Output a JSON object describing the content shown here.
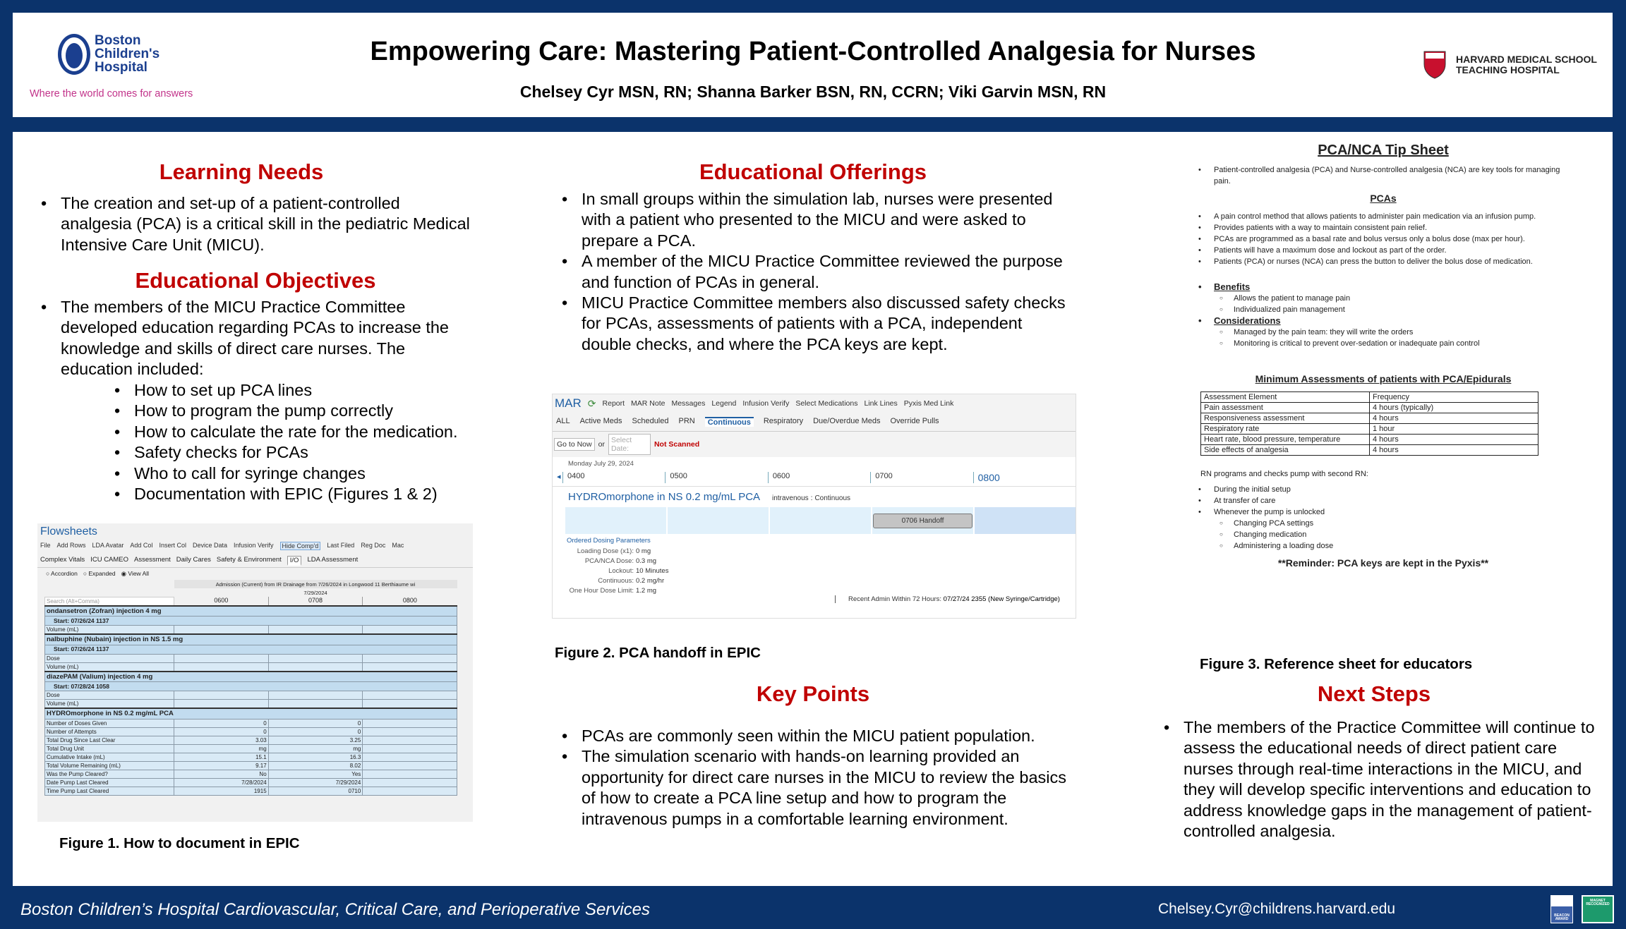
{
  "header": {
    "title": "Empowering Care: Mastering Patient-Controlled Analgesia for Nurses",
    "authors": "Chelsey Cyr MSN, RN; Shanna Barker BSN, RN, CCRN; Viki Garvin MSN, RN",
    "logo_left": {
      "name": "Boston Children's Hospital",
      "lines": [
        "Boston",
        "Children's",
        "Hospital"
      ],
      "tagline": "Where the world comes for answers"
    },
    "logo_right": {
      "lines": [
        "HARVARD MEDICAL SCHOOL",
        "TEACHING HOSPITAL"
      ]
    }
  },
  "colors": {
    "navy": "#0b336b",
    "heading_red": "#c00000",
    "tagline_pink": "#c2338a"
  },
  "learning_needs": {
    "heading": "Learning Needs",
    "bullets": [
      "The creation and set-up of a patient-controlled analgesia (PCA) is a critical skill in the pediatric Medical Intensive Care Unit (MICU)."
    ]
  },
  "objectives": {
    "heading": "Educational Objectives",
    "intro": "The members of the MICU Practice Committee developed education regarding PCAs to increase the knowledge and skills of direct care nurses. The education included:",
    "items": [
      "How to set up PCA lines",
      "How to program the pump correctly",
      "How to calculate the rate for the medication.",
      "Safety checks for PCAs",
      "Who to call for syringe changes",
      "Documentation with EPIC (Figures 1 & 2)"
    ]
  },
  "offerings": {
    "heading": "Educational Offerings",
    "bullets": [
      "In small groups within the simulation lab, nurses were presented with a patient who presented to the MICU and were asked to prepare a PCA.",
      "A member of the MICU Practice Committee reviewed the purpose and function of PCAs in general.",
      "MICU Practice Committee members also discussed safety checks for PCAs, assessments of patients with a PCA, independent double checks, and where the PCA keys are kept."
    ]
  },
  "key_points": {
    "heading": "Key Points",
    "bullets": [
      "PCAs are commonly seen within the MICU patient population.",
      "The simulation scenario with hands-on learning provided an opportunity for direct care nurses in the MICU to review the basics of how to create a PCA line setup and how to program the intravenous pumps in a comfortable learning environment."
    ]
  },
  "next_steps": {
    "heading": "Next Steps",
    "bullets": [
      "The members of the Practice Committee will continue to assess the educational needs of direct patient care nurses through real-time interactions in the MICU, and they will develop specific interventions and education to address knowledge gaps in the management of patient-controlled analgesia."
    ]
  },
  "figure1": {
    "caption": "Figure 1. How to document in EPIC",
    "title": "Flowsheets",
    "toolbar": [
      "File",
      "Add Rows",
      "LDA Avatar",
      "Add Col",
      "Insert Col",
      "Device Data",
      "Infusion Verify",
      "Hide Comp'd",
      "Last Filed",
      "Reg Doc",
      "Mac"
    ],
    "tabs": [
      "Complex Vitals",
      "ICU CAMEO",
      "Assessment",
      "Daily Cares",
      "Safety & Environment",
      "I/O",
      "LDA Assessment"
    ],
    "views": [
      "Accordion",
      "Expanded",
      "View All"
    ],
    "admission": "Admission (Current) from IR Drainage from 7/26/2024 in Longwood 11 Berthiaume wi",
    "date": "7/29/2024",
    "search_placeholder": "Search (Alt+Comma)",
    "columns": [
      "0600",
      "0708",
      "0800"
    ],
    "sections": [
      {
        "name": "ondansetron (Zofran) injection 4 mg",
        "start": "Start: 07/26/24 1137",
        "rows": [
          [
            "Volume (mL)",
            "",
            "",
            ""
          ]
        ]
      },
      {
        "name": "nalbuphine (Nubain) injection in NS 1.5 mg",
        "start": "Start: 07/26/24 1137",
        "rows": [
          [
            "Dose",
            "",
            "",
            ""
          ],
          [
            "Volume (mL)",
            "",
            "",
            ""
          ]
        ]
      },
      {
        "name": "diazePAM (Valium) injection 4 mg",
        "start": "Start: 07/28/24 1058",
        "rows": [
          [
            "Dose",
            "",
            "",
            ""
          ],
          [
            "Volume (mL)",
            "",
            "",
            ""
          ]
        ]
      },
      {
        "name": "HYDROmorphone in NS 0.2 mg/mL PCA",
        "start": null,
        "rows": [
          [
            "Number of Doses Given",
            "0",
            "0",
            ""
          ],
          [
            "Number of Attempts",
            "0",
            "0",
            ""
          ],
          [
            "Total Drug Since Last Clear",
            "3.03",
            "3.25",
            ""
          ],
          [
            "Total Drug Unit",
            "mg",
            "mg",
            ""
          ],
          [
            "Cumulative Intake (mL)",
            "15.1",
            "16.3",
            ""
          ],
          [
            "Total Volume Remaining (mL)",
            "9.17",
            "8.02",
            ""
          ],
          [
            "Was the Pump Cleared?",
            "No",
            "Yes",
            ""
          ],
          [
            "Date Pump Last Cleared",
            "7/28/2024",
            "7/29/2024",
            ""
          ],
          [
            "Time Pump Last Cleared",
            "1915",
            "0710",
            ""
          ]
        ]
      }
    ]
  },
  "figure2": {
    "caption": "Figure 2. PCA handoff in EPIC",
    "title": "MAR",
    "toolbar": [
      "Report",
      "MAR Note",
      "Messages",
      "Legend",
      "Infusion Verify",
      "Select Medications",
      "Link Lines",
      "Pyxis Med Link"
    ],
    "tabs": [
      "ALL",
      "Active Meds",
      "Scheduled",
      "PRN",
      "Continuous",
      "Respiratory",
      "Due/Overdue Meds",
      "Override Pulls"
    ],
    "go_to_now": "Go to Now",
    "or": "or",
    "select_date_placeholder": "Select Date:",
    "not_scanned": "Not Scanned",
    "date": "Monday July 29, 2024",
    "times": [
      "0400",
      "0500",
      "0600",
      "0700",
      "0800"
    ],
    "medication": "HYDROmorphone in NS 0.2 mg/mL PCA",
    "route": "intravenous",
    "frequency": "Continuous",
    "handoff": "0706 Handoff",
    "params_title": "Ordered Dosing Parameters",
    "params": [
      {
        "label": "Loading Dose (x1):",
        "value": "0 mg"
      },
      {
        "label": "PCA/NCA Dose:",
        "value": "0.3 mg"
      },
      {
        "label": "Lockout:",
        "value": "10 Minutes"
      },
      {
        "label": "Continuous:",
        "value": "0.2 mg/hr"
      },
      {
        "label": "One Hour Dose Limit:",
        "value": "1.2 mg"
      }
    ],
    "recent_label": "Recent Admin Within 72 Hours:",
    "recent_value": "07/27/24 2355 (New Syringe/Cartridge)"
  },
  "figure3": {
    "caption": "Figure 3. Reference sheet for educators",
    "title": "PCA/NCA Tip Sheet",
    "intro": "Patient-controlled analgesia (PCA) and Nurse-controlled analgesia (NCA) are key tools for managing pain.",
    "pcas_heading": "PCAs",
    "pcas": [
      "A pain control method that allows patients to administer pain medication via an infusion pump.",
      "Provides patients with a way to maintain consistent pain relief.",
      "PCAs are programmed as a basal rate and bolus versus only a bolus dose (max per hour).",
      "Patients will have a maximum dose and lockout as part of the order.",
      "Patients (PCA) or nurses (NCA) can press the button to deliver the bolus dose of medication."
    ],
    "benefits_heading": "Benefits",
    "benefits": [
      "Allows the patient to manage pain",
      "Individualized pain management"
    ],
    "considerations_heading": "Considerations",
    "considerations": [
      "Managed by the pain team: they will write the orders",
      "Monitoring is critical to prevent over-sedation or inadequate pain control"
    ],
    "table_heading": "Minimum Assessments of patients with PCA/Epidurals",
    "table": [
      [
        "Assessment Element",
        "Frequency"
      ],
      [
        "Pain assessment",
        "4 hours (typically)"
      ],
      [
        "Responsiveness assessment",
        "4 hours"
      ],
      [
        "Respiratory rate",
        "1 hour"
      ],
      [
        "Heart rate, blood pressure, temperature",
        "4 hours"
      ],
      [
        "Side effects of analgesia",
        "4 hours"
      ]
    ],
    "rn_intro": "RN programs and checks pump with second RN:",
    "rn": [
      "During the initial setup",
      "At transfer of care",
      "Whenever the pump is unlocked"
    ],
    "unlocked": [
      "Changing PCA settings",
      "Changing medication",
      "Administering a loading dose"
    ],
    "reminder": "**Reminder: PCA keys are kept in the Pyxis**"
  },
  "footer": {
    "left": "Boston Children’s Hospital Cardiovascular, Critical Care, and Perioperative Services",
    "email": "Chelsey.Cyr@childrens.harvard.edu",
    "badges": [
      "Beacon Award",
      "Magnet Recognized"
    ]
  }
}
